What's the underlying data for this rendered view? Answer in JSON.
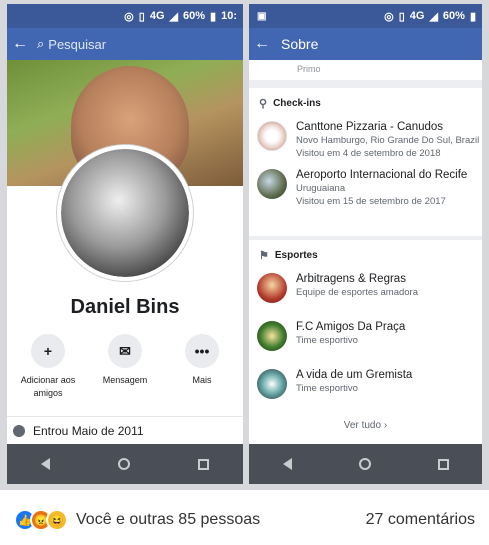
{
  "left_phone": {
    "status": {
      "network": "4G",
      "battery": "60%",
      "time": "10:"
    },
    "search": {
      "placeholder": "Pesquisar"
    },
    "profile": {
      "name": "Daniel Bins"
    },
    "actions": [
      {
        "label": "Adicionar aos amigos",
        "icon": "add-friend-icon",
        "glyph": "+"
      },
      {
        "label": "Mensagem",
        "icon": "messenger-icon",
        "glyph": "✉"
      },
      {
        "label": "Mais",
        "icon": "more-icon",
        "glyph": "•••"
      }
    ],
    "joined": "Entrou Maio de 2011"
  },
  "right_phone": {
    "status": {
      "network": "4G",
      "battery": "60%"
    },
    "header": {
      "title": "Sobre"
    },
    "top_item_sub": "Primo",
    "checkins": {
      "title": "Check-ins",
      "items": [
        {
          "title": "Canttone Pizzaria - Canudos",
          "sub1": "Novo Hamburgo, Rio Grande Do Sul, Brazil",
          "sub2": "Visitou em 4 de setembro de 2018"
        },
        {
          "title": "Aeroporto Internacional do Recife",
          "sub1": "Uruguaiana",
          "sub2": "Visitou em 15 de setembro de 2017"
        }
      ]
    },
    "sports": {
      "title": "Esportes",
      "items": [
        {
          "title": "Arbitragens & Regras",
          "sub": "Equipe de esportes amadora"
        },
        {
          "title": "F.C Amigos Da Praça",
          "sub": "Time esportivo"
        },
        {
          "title": "A vida de um Gremista",
          "sub": "Time esportivo"
        }
      ],
      "see_all": "Ver tudo",
      "see_all_chevron": "›"
    }
  },
  "footer": {
    "reactions_text": "Você e outras 85 pessoas",
    "comments_text": "27 comentários"
  },
  "colors": {
    "facebook_blue": "#4267b2",
    "status_blue": "#3b5998",
    "nav_gray": "#4a4f57"
  }
}
